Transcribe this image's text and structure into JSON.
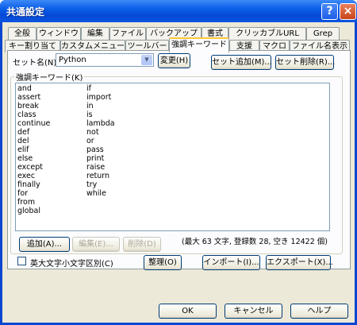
{
  "window": {
    "title": "共通設定"
  },
  "tabs_row1": [
    "全般",
    "ウィンドウ",
    "編集",
    "ファイル",
    "バックアップ",
    "書式",
    "クリッカブルURL",
    "Grep"
  ],
  "tabs_row2": [
    "キー割り当て",
    "カスタムメニュー",
    "ツールバー",
    "強調キーワード",
    "支援",
    "マクロ",
    "ファイル名表示"
  ],
  "selected_tab": "強調キーワード",
  "set_name": {
    "label": "セット名(N)",
    "value": "Python",
    "change_button": "変更(H)"
  },
  "set_add_button": "セット追加(M)...",
  "set_delete_button": "セット削除(R)...",
  "keywords_group": {
    "label": "強調キーワード(K)"
  },
  "keywords_col1": [
    "and",
    "assert",
    "break",
    "class",
    "continue",
    "def",
    "del",
    "elif",
    "else",
    "except",
    "exec",
    "finally",
    "for",
    "from",
    "global"
  ],
  "keywords_col2": [
    "if",
    "import",
    "in",
    "is",
    "lambda",
    "not",
    "or",
    "pass",
    "print",
    "raise",
    "return",
    "try",
    "while"
  ],
  "buttons": {
    "add": "追加(A)...",
    "edit": "編集(E)...",
    "delete": "削除(D)",
    "sort": "整理(O)",
    "import": "インポート(I)...",
    "export": "エクスポート(X)..."
  },
  "stats": "(最大 63 文字, 登録数 28, 空き 12422 個)",
  "case_checkbox": {
    "label": "英大文字小文字区別(C)",
    "checked": false
  },
  "footer": {
    "ok": "OK",
    "cancel": "キャンセル",
    "help": "ヘルプ"
  }
}
